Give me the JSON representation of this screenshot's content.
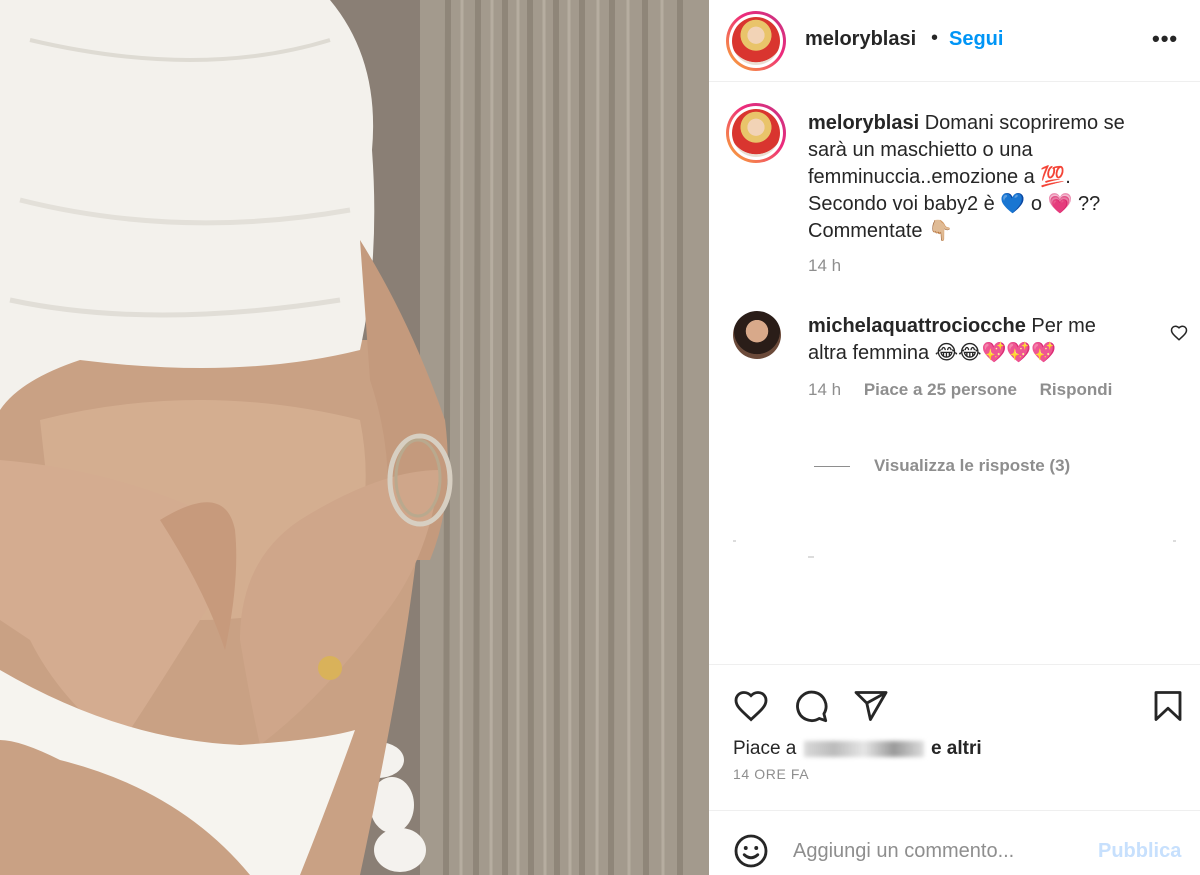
{
  "post": {
    "author": "meloryblasi",
    "follow_label": "Segui",
    "dot": "•",
    "more_label": "•••"
  },
  "caption": {
    "username": "meloryblasi",
    "line1": " Domani scopriremo se",
    "line2": "sarà un maschietto o una",
    "line3": "femminuccia..emozione a 💯.",
    "line4": "Secondo voi baby2 è 💙 o 💗 ??",
    "line5": "Commentate 👇🏼",
    "time": "14 h"
  },
  "comment": {
    "username": "michelaquattrociocche",
    "text_part1": " Per me",
    "text_part2": "altra femmina 😂😂💖💖💖",
    "time": "14 h",
    "likes": "Piace a 25 persone",
    "reply_label": "Rispondi",
    "view_replies": "Visualizza le risposte (3)"
  },
  "actions": {
    "like_icon": "heart-icon",
    "comment_icon": "comment-bubble-icon",
    "share_icon": "paper-plane-icon",
    "save_icon": "bookmark-icon"
  },
  "likes": {
    "prefix": "Piace a",
    "suffix": "e altri"
  },
  "timestamp": "14 ORE FA",
  "composer": {
    "placeholder": "Aggiungi un commento...",
    "publish_label": "Pubblica"
  }
}
